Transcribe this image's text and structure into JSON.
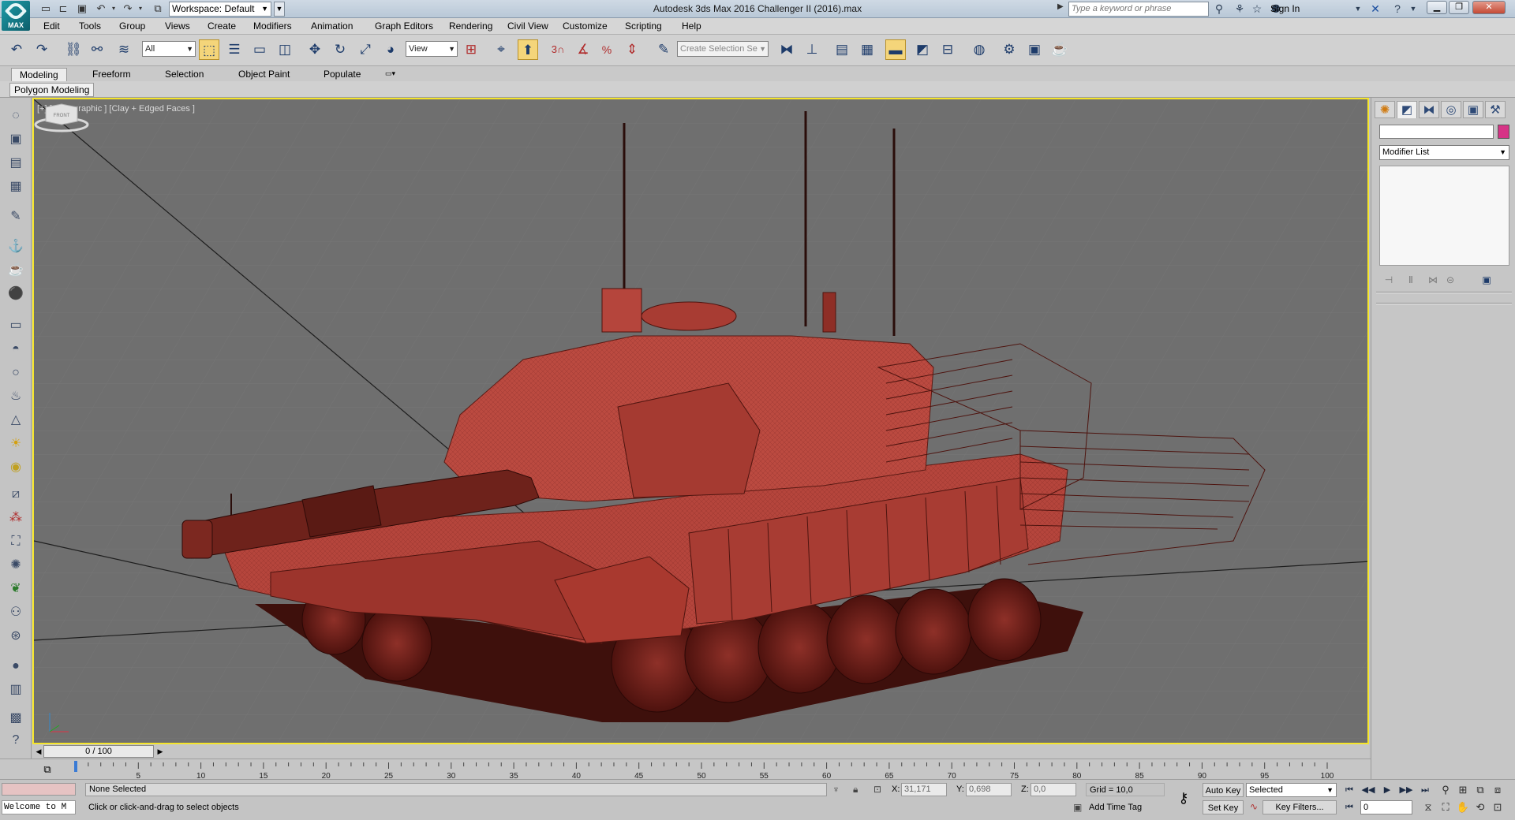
{
  "title_bar": {
    "app_title": "Autodesk 3ds Max 2016      Challenger II (2016).max",
    "workspace": "Workspace: Default",
    "search_placeholder": "Type a keyword or phrase",
    "sign_in": "Sign In",
    "logo_text": "MAX"
  },
  "menu": [
    "Edit",
    "Tools",
    "Group",
    "Views",
    "Create",
    "Modifiers",
    "Animation",
    "Graph Editors",
    "Rendering",
    "Civil View",
    "Customize",
    "Scripting",
    "Help"
  ],
  "toolbar": {
    "filter_value": "All",
    "refcoord_value": "View",
    "selection_set_placeholder": "Create Selection Se",
    "snap_label": "3"
  },
  "ribbon": {
    "tabs": [
      "Modeling",
      "Freeform",
      "Selection",
      "Object Paint",
      "Populate"
    ],
    "active_tab": "Modeling",
    "panel_tab": "Polygon Modeling"
  },
  "viewport": {
    "label": "[+] [Orthographic ] [Clay + Edged Faces ]",
    "model_color": "#b5453c",
    "bg_color": "#6f6f6f",
    "viewcube_label": "FRONT"
  },
  "command_panel": {
    "modifier_list": "Modifier List",
    "object_color": "#d63386"
  },
  "timeline": {
    "position": "0 / 100",
    "ticks": [
      "5",
      "10",
      "15",
      "20",
      "25",
      "30",
      "35",
      "40",
      "45",
      "50",
      "55",
      "60",
      "65",
      "70",
      "75",
      "80",
      "85",
      "90",
      "95",
      "100"
    ]
  },
  "status": {
    "listener": "Welcome to M",
    "selection": "None Selected",
    "prompt": "Click or click-and-drag to select objects",
    "x_label": "X:",
    "x_value": "31,171",
    "y_label": "Y:",
    "y_value": "0,698",
    "z_label": "Z:",
    "z_value": "0,0",
    "grid": "Grid = 10,0",
    "add_time_tag": "Add Time Tag",
    "auto_key": "Auto Key",
    "set_key": "Set Key",
    "selected": "Selected",
    "key_filters": "Key Filters...",
    "frame": "0"
  }
}
